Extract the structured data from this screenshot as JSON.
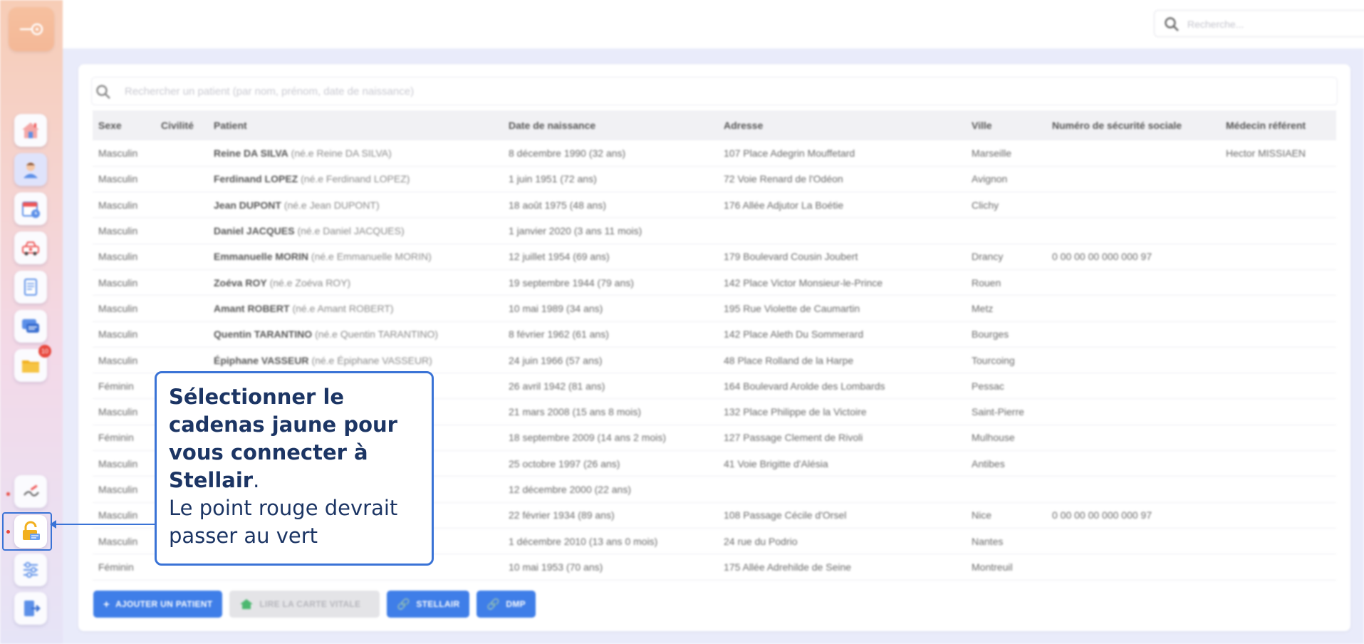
{
  "top_search": {
    "placeholder": "Recherche..."
  },
  "patient_search": {
    "placeholder": "Rechercher un patient (par nom, prénom, date de naissance)"
  },
  "sidebar": {
    "items": [
      {
        "name": "home",
        "icon": "home-icon"
      },
      {
        "name": "patients",
        "icon": "patient-icon"
      },
      {
        "name": "agenda",
        "icon": "calendar-icon"
      },
      {
        "name": "tournee",
        "icon": "car-icon"
      },
      {
        "name": "documents",
        "icon": "document-icon"
      },
      {
        "name": "messages",
        "icon": "chat-icon"
      },
      {
        "name": "dossiers",
        "icon": "folder-icon",
        "badge": "10"
      }
    ],
    "bottom_items": [
      {
        "name": "signature",
        "icon": "signature-icon"
      },
      {
        "name": "stellair-lock",
        "icon": "lock-icon"
      },
      {
        "name": "reglages",
        "icon": "sliders-icon"
      },
      {
        "name": "deconnexion",
        "icon": "logout-icon"
      }
    ]
  },
  "table": {
    "headers": [
      "Sexe",
      "Civilité",
      "Patient",
      "Date de naissance",
      "Adresse",
      "Ville",
      "Numéro de sécurité sociale",
      "Médecin référent"
    ],
    "rows": [
      {
        "sexe": "Masculin",
        "civilite": "",
        "name": "Reine DA SILVA",
        "birth_name": "(né.e Reine DA SILVA)",
        "dob": "8 décembre 1990 (32 ans)",
        "address": "107 Place Adegrin Mouffetard",
        "city": "Marseille",
        "ssn": "",
        "doctor": "Hector MISSIAEN"
      },
      {
        "sexe": "Masculin",
        "civilite": "",
        "name": "Ferdinand LOPEZ",
        "birth_name": "(né.e Ferdinand LOPEZ)",
        "dob": "1 juin 1951 (72 ans)",
        "address": "72 Voie Renard de l'Odéon",
        "city": "Avignon",
        "ssn": "",
        "doctor": ""
      },
      {
        "sexe": "Masculin",
        "civilite": "",
        "name": "Jean DUPONT",
        "birth_name": "(né.e Jean DUPONT)",
        "dob": "18 août 1975 (48 ans)",
        "address": "176 Allée Adjutor La Boétie",
        "city": "Clichy",
        "ssn": "",
        "doctor": ""
      },
      {
        "sexe": "Masculin",
        "civilite": "",
        "name": "Daniel JACQUES",
        "birth_name": "(né.e Daniel JACQUES)",
        "dob": "1 janvier 2020 (3 ans 11 mois)",
        "address": "",
        "city": "",
        "ssn": "",
        "doctor": ""
      },
      {
        "sexe": "Masculin",
        "civilite": "",
        "name": "Emmanuelle MORIN",
        "birth_name": "(né.e Emmanuelle MORIN)",
        "dob": "12 juillet 1954 (69 ans)",
        "address": "179 Boulevard Cousin Joubert",
        "city": "Drancy",
        "ssn": "0 00 00 00 000 000 97",
        "doctor": ""
      },
      {
        "sexe": "Masculin",
        "civilite": "",
        "name": "Zoéva ROY",
        "birth_name": "(né.e Zoéva ROY)",
        "dob": "19 septembre 1944 (79 ans)",
        "address": "142 Place Victor Monsieur-le-Prince",
        "city": "Rouen",
        "ssn": "",
        "doctor": ""
      },
      {
        "sexe": "Masculin",
        "civilite": "",
        "name": "Amant ROBERT",
        "birth_name": "(né.e Amant ROBERT)",
        "dob": "10 mai 1989 (34 ans)",
        "address": "195 Rue Violette de Caumartin",
        "city": "Metz",
        "ssn": "",
        "doctor": ""
      },
      {
        "sexe": "Masculin",
        "civilite": "",
        "name": "Quentin TARANTINO",
        "birth_name": "(né.e Quentin TARANTINO)",
        "dob": "8 février 1962 (61 ans)",
        "address": "142 Place Aleth Du Sommerard",
        "city": "Bourges",
        "ssn": "",
        "doctor": ""
      },
      {
        "sexe": "Masculin",
        "civilite": "",
        "name": "Épiphane VASSEUR",
        "birth_name": "(né.e Épiphane VASSEUR)",
        "dob": "24 juin 1966 (57 ans)",
        "address": "48 Place Rolland de la Harpe",
        "city": "Tourcoing",
        "ssn": "",
        "doctor": ""
      },
      {
        "sexe": "Féminin",
        "civilite": "",
        "name": "",
        "birth_name": "",
        "dob": "26 avril 1942 (81 ans)",
        "address": "164 Boulevard Arolde des Lombards",
        "city": "Pessac",
        "ssn": "",
        "doctor": ""
      },
      {
        "sexe": "Masculin",
        "civilite": "",
        "name": "",
        "birth_name": "",
        "dob": "21 mars 2008 (15 ans 8 mois)",
        "address": "132 Place Philippe de la Victoire",
        "city": "Saint-Pierre",
        "ssn": "",
        "doctor": ""
      },
      {
        "sexe": "Féminin",
        "civilite": "",
        "name": "",
        "birth_name": "",
        "dob": "18 septembre 2009 (14 ans 2 mois)",
        "address": "127 Passage Clement de Rivoli",
        "city": "Mulhouse",
        "ssn": "",
        "doctor": ""
      },
      {
        "sexe": "Masculin",
        "civilite": "",
        "name": "",
        "birth_name": "",
        "dob": "25 octobre 1997 (26 ans)",
        "address": "41 Voie Brigitte d'Alésia",
        "city": "Antibes",
        "ssn": "",
        "doctor": ""
      },
      {
        "sexe": "Masculin",
        "civilite": "",
        "name": "",
        "birth_name": "",
        "dob": "12 décembre 2000 (22 ans)",
        "address": "",
        "city": "",
        "ssn": "",
        "doctor": ""
      },
      {
        "sexe": "Masculin",
        "civilite": "",
        "name": "",
        "birth_name": "",
        "dob": "22 février 1934 (89 ans)",
        "address": "108 Passage Cécile d'Orsel",
        "city": "Nice",
        "ssn": "0 00 00 00 000 000 97",
        "doctor": ""
      },
      {
        "sexe": "Masculin",
        "civilite": "",
        "name": "",
        "birth_name": "",
        "dob": "1 décembre 2010 (13 ans 0 mois)",
        "address": "24 rue du Podrio",
        "city": "Nantes",
        "ssn": "",
        "doctor": ""
      },
      {
        "sexe": "Féminin",
        "civilite": "",
        "name": "",
        "birth_name": "",
        "dob": "10 mai 1953 (70 ans)",
        "address": "175 Allée Adrehilde de Seine",
        "city": "Montreuil",
        "ssn": "",
        "doctor": ""
      }
    ]
  },
  "footer": {
    "add_patient": "AJOUTER UN PATIENT",
    "read_card": "LIRE LA CARTE VITALE",
    "stellair": "STELLAIR",
    "dmp": "DMP"
  },
  "tooltip": {
    "bold_text": "Sélectionner le cadenas jaune pour vous connecter à Stellair",
    "bold_suffix": ".",
    "body_text": "Le point rouge devrait passer au vert"
  },
  "colors": {
    "accent": "#3a73d6",
    "primary_button": "#3f7ee8",
    "tooltip_text": "#1c3564",
    "status_red": "#e8483e",
    "lock_yellow": "#f2b01e"
  }
}
